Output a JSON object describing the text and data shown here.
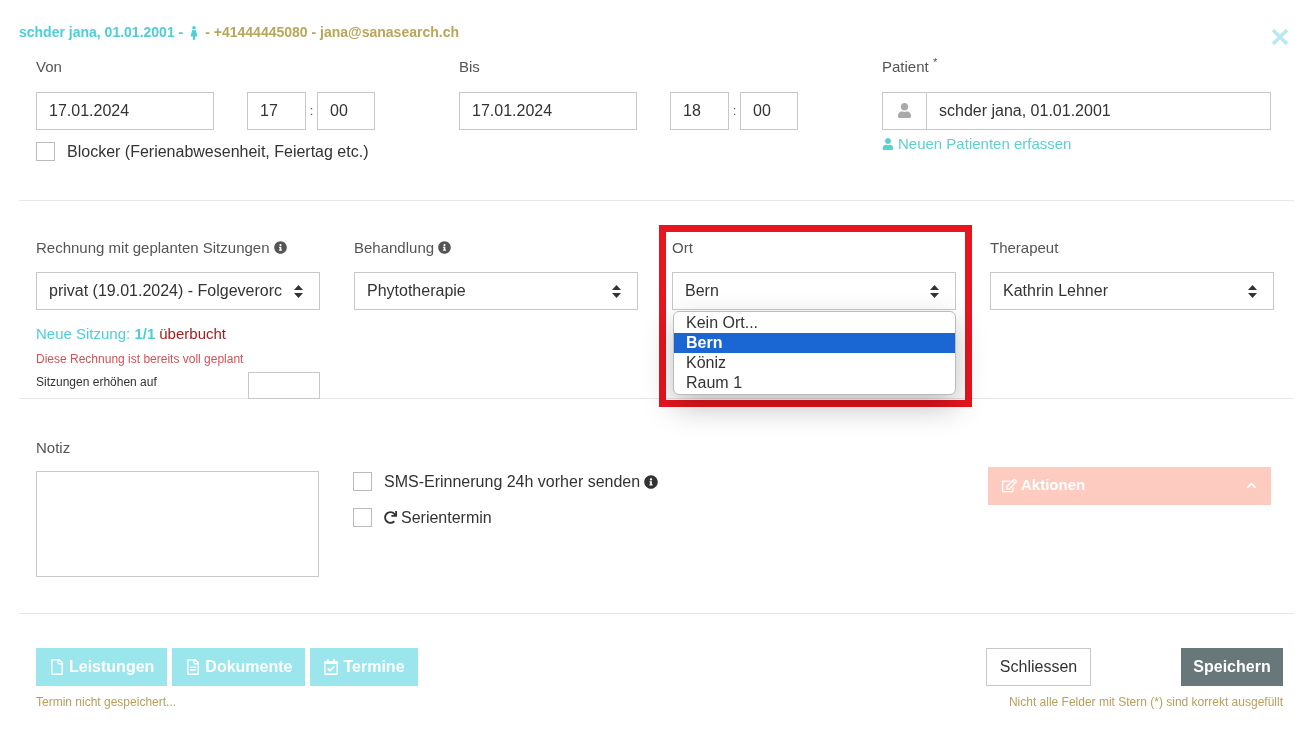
{
  "header": {
    "patient": "schder jana, 01.01.2001 -",
    "contact": "- +41444445080 - jana@sanasearch.ch"
  },
  "von": {
    "label": "Von",
    "date": "17.01.2024",
    "hour": "17",
    "minute": "00"
  },
  "bis": {
    "label": "Bis",
    "date": "17.01.2024",
    "hour": "18",
    "minute": "00"
  },
  "time_separator": ":",
  "patient": {
    "label": "Patient",
    "required_mark": "*",
    "value": "schder jana, 01.01.2001",
    "new_link": "Neuen Patienten erfassen"
  },
  "blocker": {
    "label": "Blocker (Ferienabwesenheit, Feiertag etc.)",
    "checked": false
  },
  "rechnung": {
    "label": "Rechnung mit geplanten Sitzungen",
    "value": "privat (19.01.2024) - Folgeverorc",
    "status": "Neue Sitzung: **1/1**",
    "status_warning": "überbucht",
    "error": "Diese Rechnung ist bereits voll geplant",
    "increase_label": "Sitzungen erhöhen auf"
  },
  "behandlung": {
    "label": "Behandlung",
    "value": "Phytotherapie"
  },
  "ort": {
    "label": "Ort",
    "value": "Bern",
    "highlighted": true,
    "expanded": true,
    "options": [
      {
        "label": "Kein Ort...",
        "selected": false
      },
      {
        "label": "Bern",
        "selected": true
      },
      {
        "label": "Köniz",
        "selected": false
      },
      {
        "label": "Raum 1",
        "selected": false
      }
    ]
  },
  "therapeut": {
    "label": "Therapeut",
    "value": "Kathrin Lehner"
  },
  "notiz": {
    "label": "Notiz"
  },
  "options": [
    {
      "label": "SMS-Erinnerung 24h vorher senden",
      "checked": false,
      "kind": "info"
    },
    {
      "label": "Serientermin",
      "checked": false,
      "kind": "repeat"
    }
  ],
  "aktionen": {
    "label": "Aktionen",
    "disabled": true
  },
  "footer_buttons": [
    {
      "label": "Leistungen",
      "kind": "file",
      "disabled": true
    },
    {
      "label": "Dokumente",
      "kind": "document",
      "disabled": true
    },
    {
      "label": "Termine",
      "kind": "calendar",
      "disabled": true
    }
  ],
  "footer_note": "Termin nicht gespeichert...",
  "close_button": "Schliessen",
  "save_button": {
    "label": "Speichern",
    "disabled": false
  },
  "save_note": "Nicht alle Felder mit Stern (*) sind korrekt ausgefüllt"
}
